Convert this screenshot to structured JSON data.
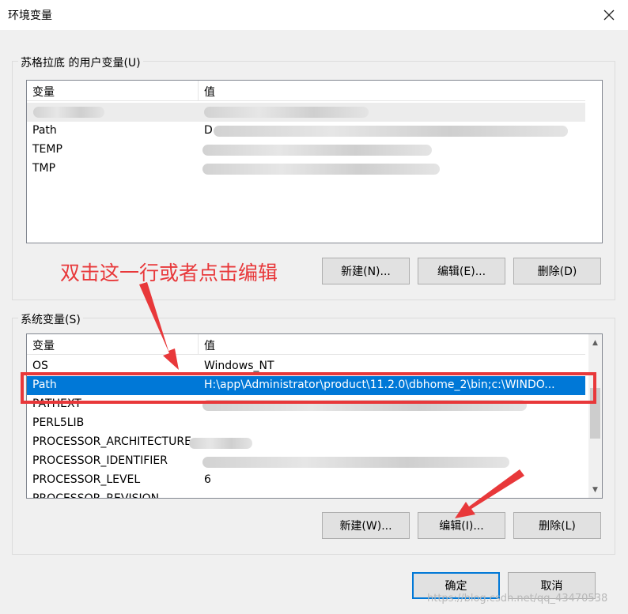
{
  "window": {
    "title": "环境变量"
  },
  "user_section": {
    "label": "苏格拉底 的用户变量(U)",
    "columns": [
      "变量",
      "值"
    ],
    "rows": [
      {
        "name": "",
        "value": ""
      },
      {
        "name": "Path",
        "value": "D"
      },
      {
        "name": "TEMP",
        "value": ""
      },
      {
        "name": "TMP",
        "value": ""
      }
    ],
    "buttons": {
      "new": "新建(N)...",
      "edit": "编辑(E)...",
      "delete": "删除(D)"
    }
  },
  "annotation": {
    "text": "双击这一行或者点击编辑"
  },
  "system_section": {
    "label": "系统变量(S)",
    "columns": [
      "变量",
      "值"
    ],
    "rows": [
      {
        "name": "OS",
        "value": "Windows_NT"
      },
      {
        "name": "Path",
        "value": "H:\\app\\Administrator\\product\\11.2.0\\dbhome_2\\bin;c:\\WINDO..."
      },
      {
        "name": "PATHEXT",
        "value": ""
      },
      {
        "name": "PERL5LIB",
        "value": ""
      },
      {
        "name": "PROCESSOR_ARCHITECTURE",
        "value": ""
      },
      {
        "name": "PROCESSOR_IDENTIFIER",
        "value": ""
      },
      {
        "name": "PROCESSOR_LEVEL",
        "value": "6"
      },
      {
        "name": "PROCESSOR_REVISION",
        "value": ""
      }
    ],
    "buttons": {
      "new": "新建(W)...",
      "edit": "编辑(I)...",
      "delete": "删除(L)"
    }
  },
  "footer": {
    "ok": "确定",
    "cancel": "取消"
  },
  "watermark": "https://blog.csdn.net/qq_43470538",
  "colors": {
    "selection": "#0078d7",
    "annotation": "#e8383a"
  }
}
